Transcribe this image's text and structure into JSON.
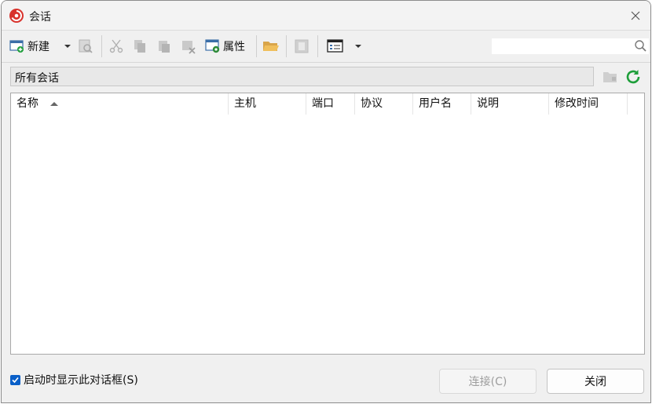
{
  "window": {
    "title": "会话"
  },
  "toolbar": {
    "new_label": "新建",
    "properties_label": "属性",
    "search_value": ""
  },
  "path_bar": {
    "text": "所有会话"
  },
  "columns": [
    "名称",
    "主机",
    "端口",
    "协议",
    "用户名",
    "说明",
    "修改时间"
  ],
  "footer": {
    "show_on_startup_label": "启动时显示此对话框(S)",
    "show_on_startup_checked": true,
    "connect_label": "连接(C)",
    "close_label": "关闭"
  },
  "colors": {
    "accent": "#0a5fc8",
    "refresh_green": "#1e9e3a",
    "logo_red": "#d8322c"
  }
}
